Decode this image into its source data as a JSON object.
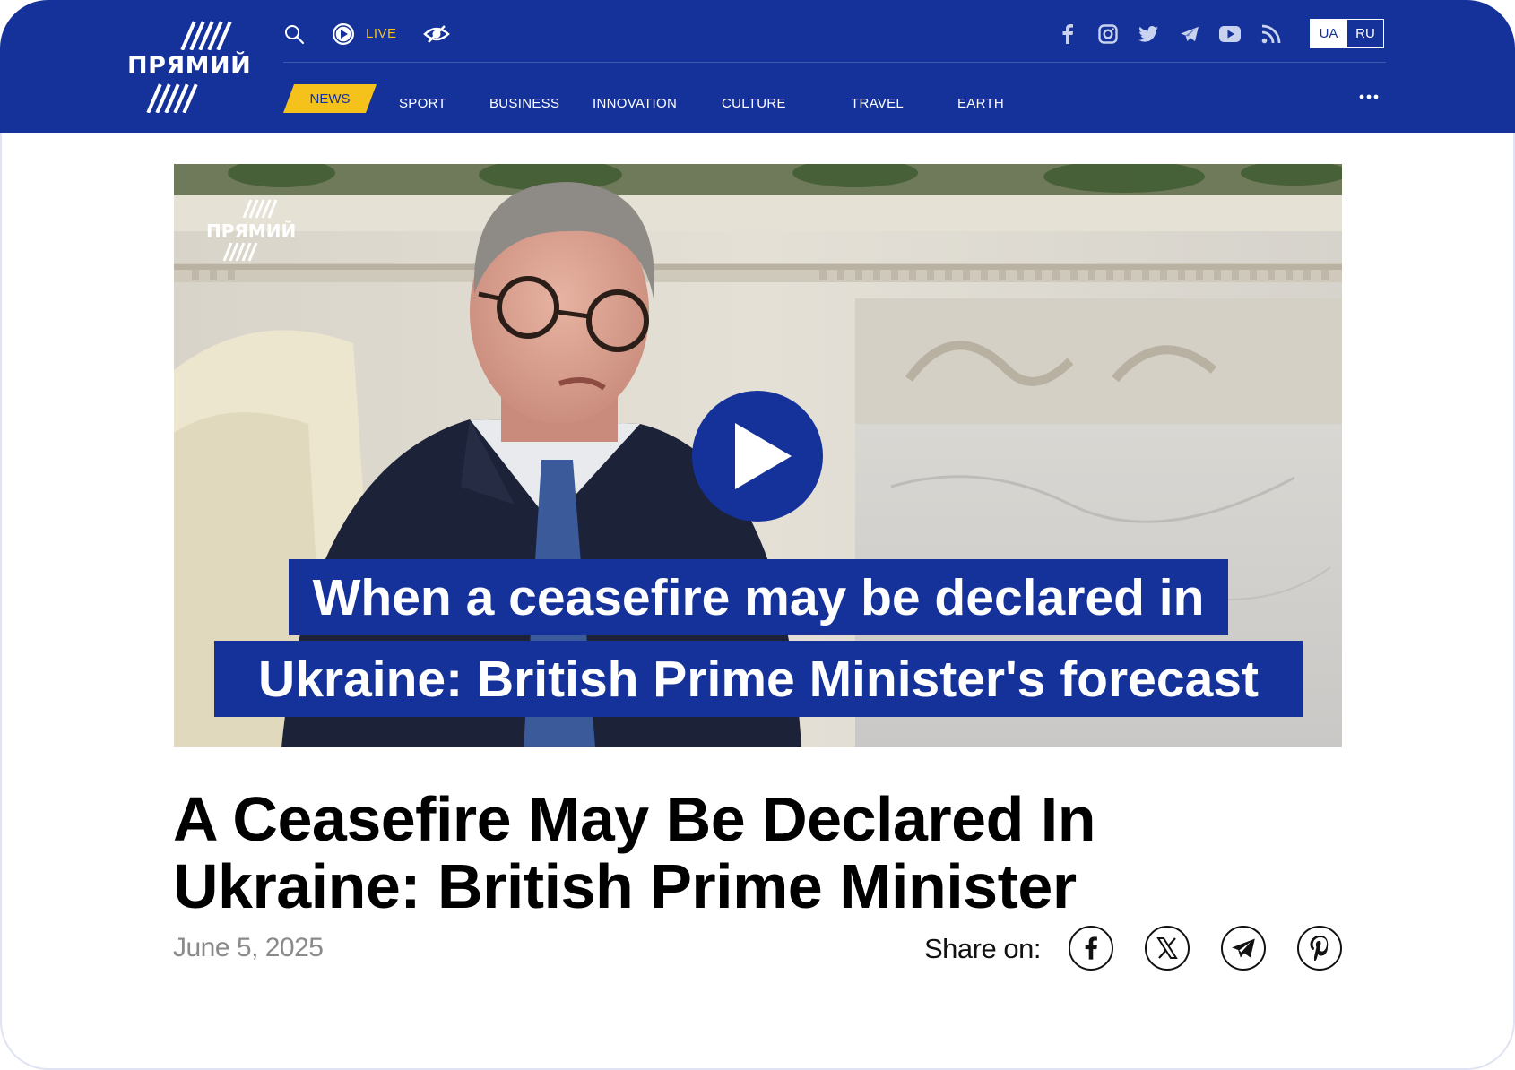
{
  "header": {
    "logo_text": "ПРЯМИЙ",
    "live_label": "LIVE",
    "nav": [
      "NEWS",
      "SPORT",
      "BUSINESS",
      "INNOVATION",
      "CULTURE",
      "TRAVEL",
      "EARTH"
    ],
    "languages": [
      "UA",
      "RU"
    ],
    "active_language": "UA",
    "active_nav": "NEWS",
    "social_icons": [
      "facebook-icon",
      "instagram-icon",
      "twitter-icon",
      "telegram-icon",
      "youtube-icon",
      "rss-icon"
    ]
  },
  "video": {
    "watermark_text": "ПРЯМИЙ",
    "caption_line1": "When a ceasefire may be declared in",
    "caption_line2": "Ukraine: British Prime Minister's forecast"
  },
  "article": {
    "headline_line1": "A Ceasefire May Be Declared In",
    "headline_line2": "Ukraine: British Prime Minister",
    "date": "June 5, 2025",
    "share_label": "Share on:",
    "share_icons": [
      "facebook-icon",
      "x-icon",
      "telegram-icon",
      "pinterest-icon"
    ]
  },
  "colors": {
    "brand_blue": "#15329a",
    "accent_yellow": "#f4c21a",
    "date_gray": "#8a8a8a"
  }
}
